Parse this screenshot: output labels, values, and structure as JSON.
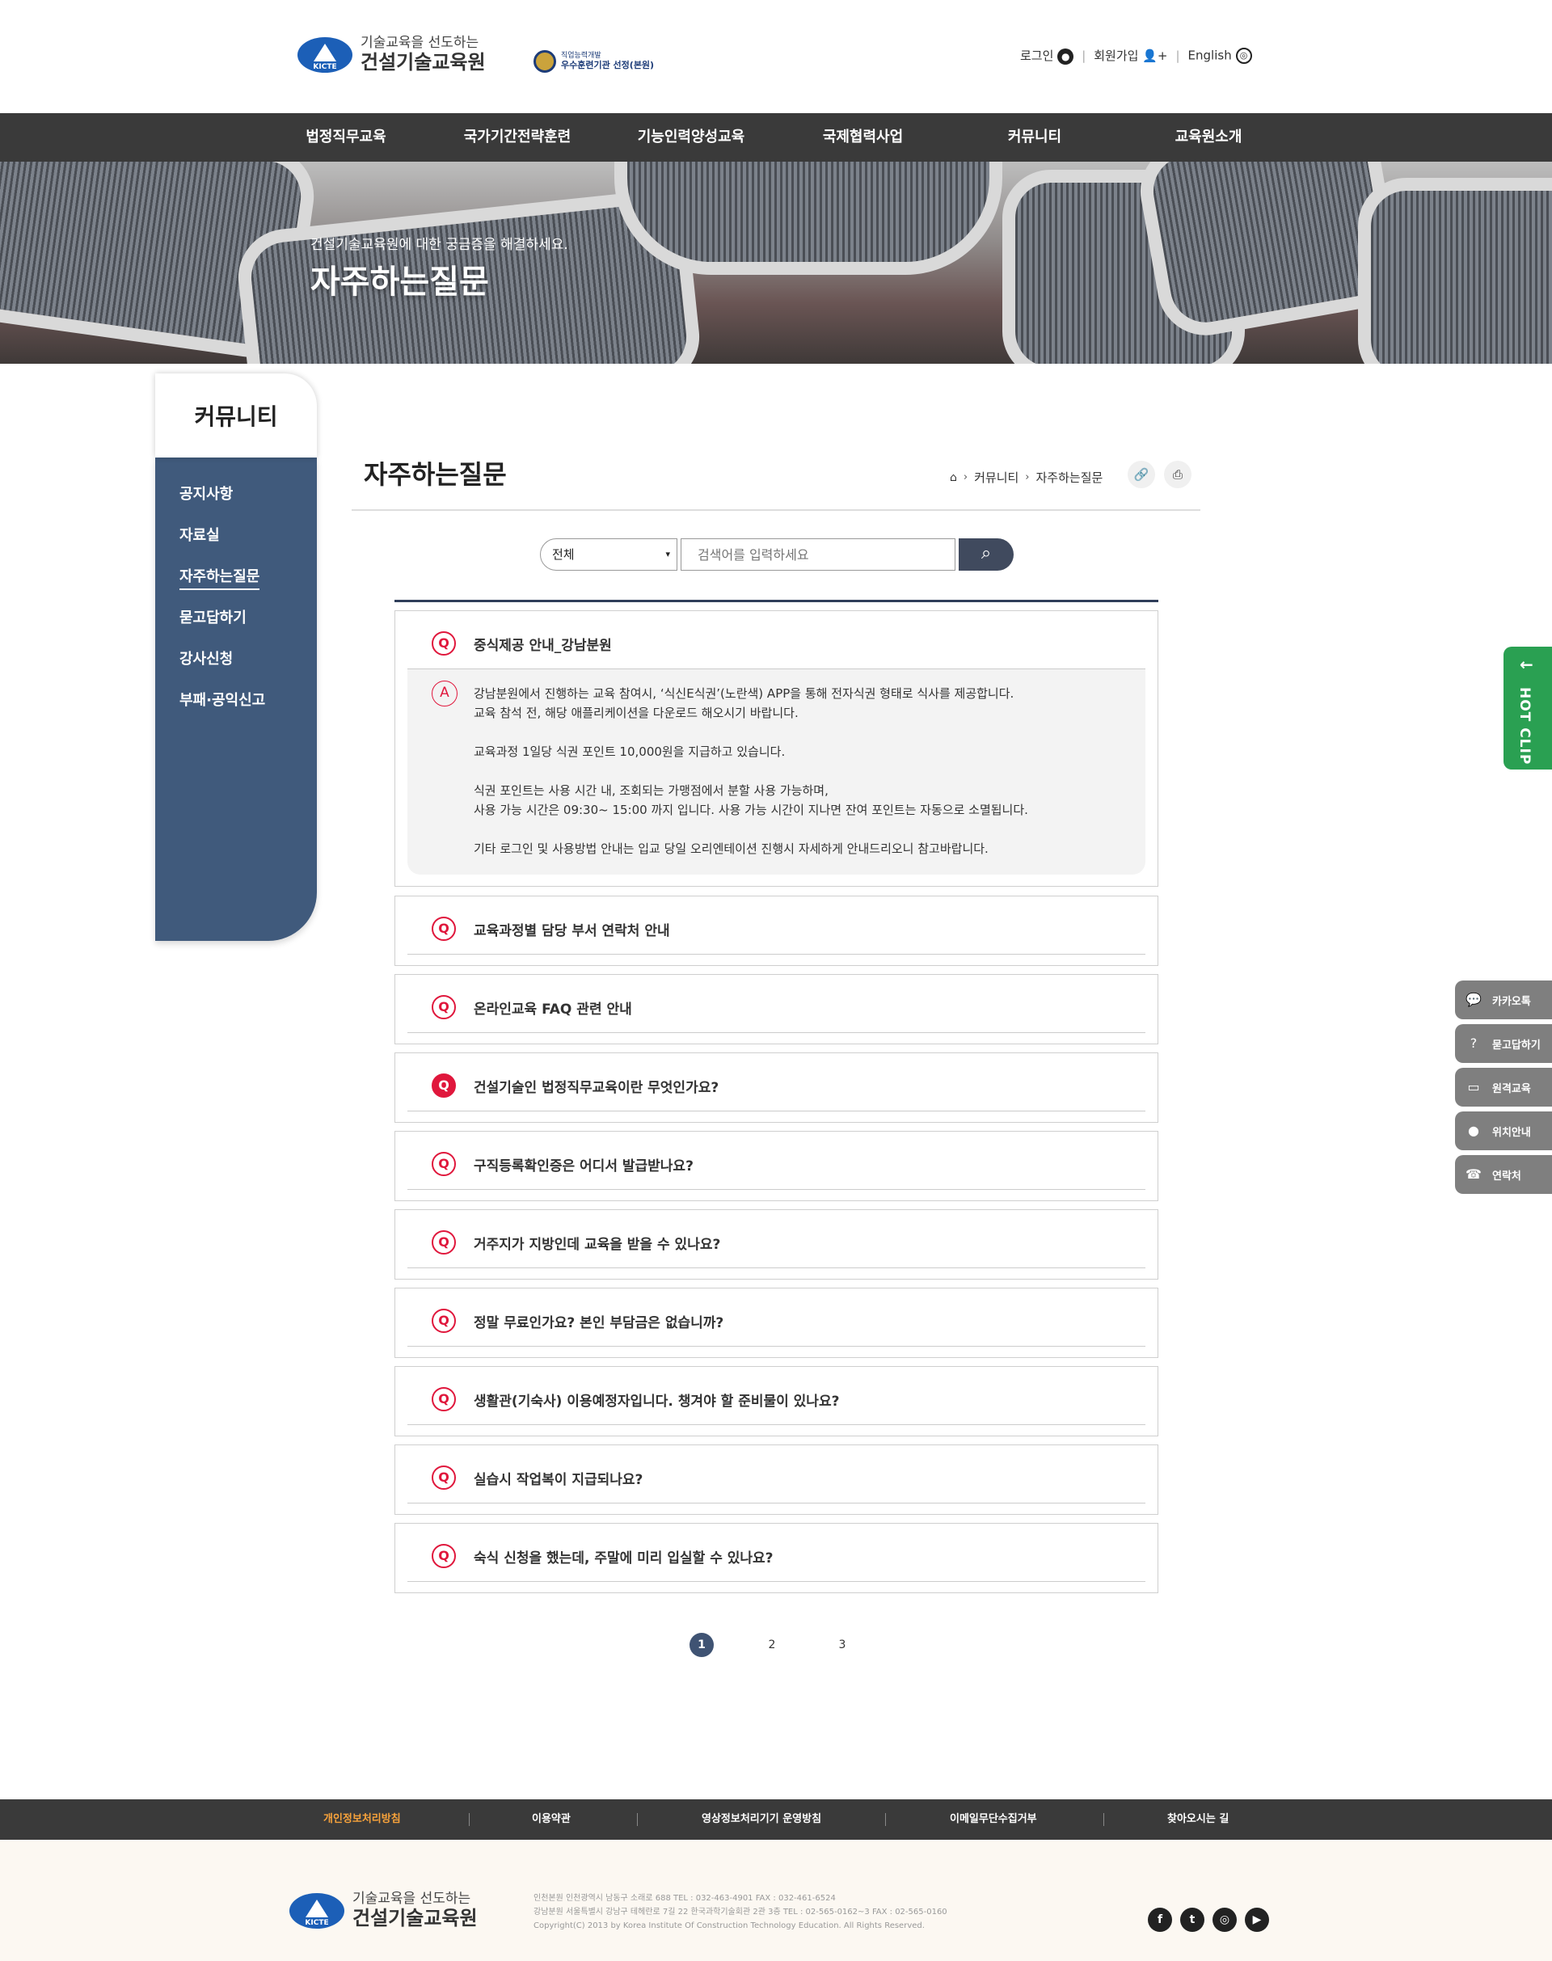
{
  "header": {
    "logo_tagline": "기술교육을 선도하는",
    "logo_name": "건설기술교육원",
    "logo_mark": "KICTE",
    "badge_line1": "직업능력개발",
    "badge_line2": "우수훈련기관 선정(본원)",
    "login": "로그인",
    "join": "회원가입",
    "lang": "English"
  },
  "gnb": [
    "법정직무교육",
    "국가기간전략훈련",
    "기능인력양성교육",
    "국제협력사업",
    "커뮤니티",
    "교육원소개"
  ],
  "hero": {
    "subtitle": "건설기술교육원에 대한 궁금증을 해결하세요.",
    "title": "자주하는질문"
  },
  "lnb": {
    "title": "커뮤니티",
    "items": [
      "공지사항",
      "자료실",
      "자주하는질문",
      "묻고답하기",
      "강사신청",
      "부패·공익신고"
    ],
    "active_index": 2
  },
  "page": {
    "title": "자주하는질문",
    "breadcrumb": [
      "커뮤니티",
      "자주하는질문"
    ],
    "icons": [
      "home-icon",
      "link-icon",
      "print-icon"
    ]
  },
  "search": {
    "select_value": "전체",
    "placeholder": "검색어를 입력하세요"
  },
  "faq": {
    "open_question": "중식제공 안내_강남분원",
    "answer": [
      [
        "강남분원에서 진행하는 교육 참여시, ‘식신E식권’(노란색) APP을 통해 전자식권 형태로 식사를 제공합니다.",
        "교육 참석 전, 해당 애플리케이션을 다운로드 해오시기 바랍니다."
      ],
      [
        "교육과정 1일당 식권 포인트 10,000원을 지급하고 있습니다."
      ],
      [
        "식권 포인트는 사용 시간 내, 조회되는 가맹점에서 분할 사용 가능하며,",
        "사용 가능 시간은 09:30~ 15:00 까지 입니다. 사용 가능 시간이 지나면 잔여 포인트는 자동으로 소멸됩니다."
      ],
      [
        "기타 로그인 및 사용방법 안내는 입교 당일 오리엔테이션 진행시 자세하게 안내드리오니 참고바랍니다."
      ]
    ],
    "questions": [
      "교육과정별 담당 부서 연락처 안내",
      "온라인교육 FAQ 관련 안내",
      "건설기술인 법정직무교육이란 무엇인가요?",
      "구직등록확인증은 어디서 발급받나요?",
      "거주지가 지방인데 교육을 받을 수 있나요?",
      "정말 무료인가요? 본인 부담금은 없습니까?",
      "생활관(기숙사) 이용예정자입니다. 챙겨야 할 준비물이 있나요?",
      "실습시 작업복이 지급되나요?",
      "숙식 신청을 했는데, 주말에 미리 입실할 수 있나요?"
    ],
    "q_label": "Q",
    "a_label": "A",
    "highlighted_index": 2
  },
  "pagination": [
    "1",
    "2",
    "3"
  ],
  "hotclip": "HOT CLIP",
  "quick_menu": [
    {
      "label": "카카오톡",
      "icon": "chat-icon"
    },
    {
      "label": "묻고답하기",
      "icon": "question-icon"
    },
    {
      "label": "원격교육",
      "icon": "monitor-icon"
    },
    {
      "label": "위치안내",
      "icon": "location-pin-icon"
    },
    {
      "label": "연락처",
      "icon": "phone-icon"
    }
  ],
  "footer": {
    "links": [
      "개인정보처리방침",
      "이용약관",
      "영상정보처리기기 운영방침",
      "이메일무단수집거부",
      "찾아오시는 길"
    ],
    "info": [
      "인천본원    인천광역시 남동구 소래로 688    TEL : 032-463-4901    FAX : 032-461-6524",
      "강남분원    서울특별시 강남구 테헤란로 7길 22 한국과학기술회관 2관 3층    TEL : 02-565-0162~3    FAX : 02-565-0160",
      "Copyright(C) 2013 by Korea Institute Of Construction Technology Education. All Rights Reserved."
    ],
    "sns": [
      "facebook-icon",
      "twitter-icon",
      "instagram-icon",
      "youtube-icon"
    ]
  },
  "colors": {
    "accent": "#e0173c",
    "nav": "#3a3a3a",
    "lnb": "#405a7c",
    "hotclip": "#2aa052",
    "footer_highlight": "#f7a23b"
  }
}
